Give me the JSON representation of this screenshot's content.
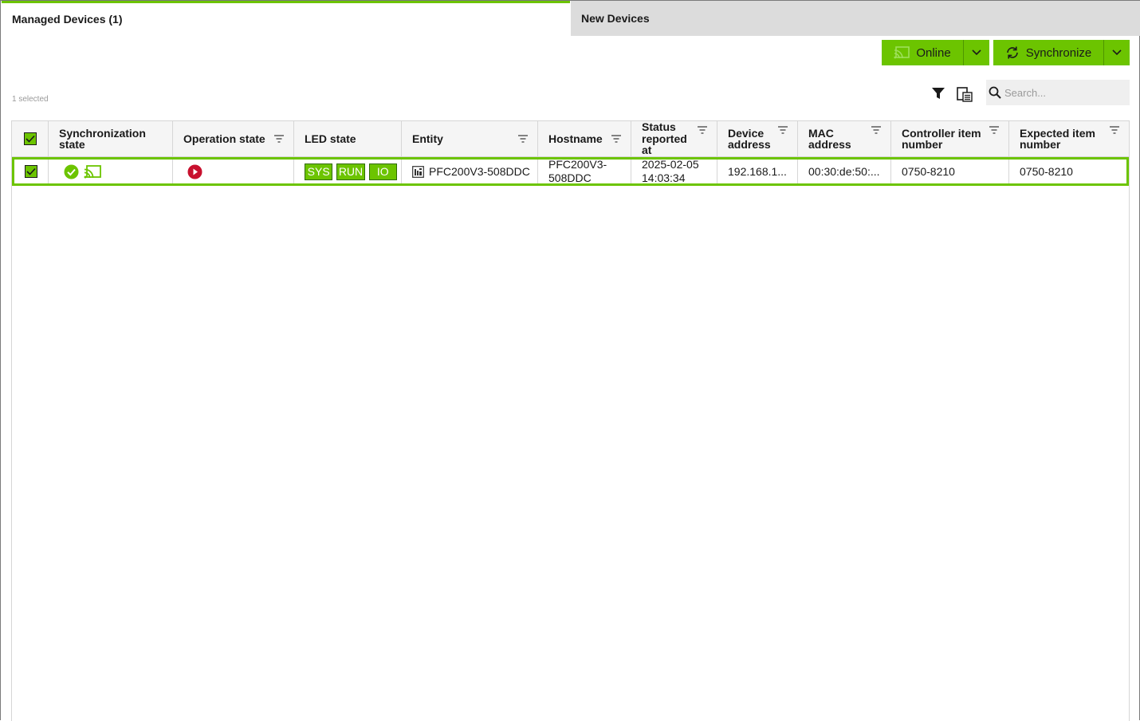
{
  "tabs": [
    {
      "label": "Managed Devices (1)",
      "active": true
    },
    {
      "label": "New Devices",
      "active": false
    }
  ],
  "toolbar": {
    "online_label": "Online",
    "synchronize_label": "Synchronize",
    "selected_count": "1 selected",
    "search_placeholder": "Search..."
  },
  "colors": {
    "accent": "#6cc400",
    "error": "#c8102e"
  },
  "columns": [
    {
      "label_lines": [
        "Synchronization",
        "state"
      ],
      "sortable": false
    },
    {
      "label_lines": [
        "Operation state"
      ],
      "sortable": true
    },
    {
      "label_lines": [
        "LED state"
      ],
      "sortable": false
    },
    {
      "label_lines": [
        "Entity"
      ],
      "sortable": true
    },
    {
      "label_lines": [
        "Hostname"
      ],
      "sortable": true
    },
    {
      "label_lines": [
        "Status",
        "reported",
        "at"
      ],
      "sortable": true
    },
    {
      "label_lines": [
        "Device",
        "address"
      ],
      "sortable": true
    },
    {
      "label_lines": [
        "MAC",
        "address"
      ],
      "sortable": true
    },
    {
      "label_lines": [
        "Controller item",
        "number"
      ],
      "sortable": true
    },
    {
      "label_lines": [
        "Expected item",
        "number"
      ],
      "sortable": true
    }
  ],
  "rows": [
    {
      "selected": true,
      "sync_icons": [
        "check-circle-icon",
        "cast-online-icon"
      ],
      "operation_icon": "play-circle-icon",
      "leds": [
        "SYS",
        "RUN",
        "IO"
      ],
      "entity": "PFC200V3-508DDC",
      "hostname_lines": [
        "PFC200V3-",
        "508DDC"
      ],
      "status_lines": [
        "2025-02-05",
        "14:03:34"
      ],
      "device_address": "192.168.1...",
      "mac_address": "00:30:de:50:...",
      "controller_item": "0750-8210",
      "expected_item": "0750-8210"
    }
  ]
}
